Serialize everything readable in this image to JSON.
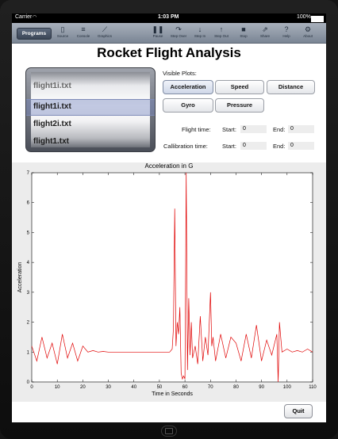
{
  "status": {
    "carrier": "Carrier",
    "time": "1:03 PM",
    "battery": "100%"
  },
  "toolbar": {
    "programs": "Programs",
    "items": [
      {
        "label": "Source",
        "icon": "document-icon"
      },
      {
        "label": "Console",
        "icon": "console-icon"
      },
      {
        "label": "Graphics",
        "icon": "graph-icon"
      },
      {
        "label": "Pause",
        "icon": "pause-icon"
      },
      {
        "label": "Step Over",
        "icon": "step-over-icon"
      },
      {
        "label": "Step In",
        "icon": "step-in-icon"
      },
      {
        "label": "Step Out",
        "icon": "step-out-icon"
      },
      {
        "label": "Stop",
        "icon": "stop-icon"
      },
      {
        "label": "Share",
        "icon": "share-icon"
      },
      {
        "label": "Help",
        "icon": "help-icon"
      },
      {
        "label": "About",
        "icon": "gear-icon"
      }
    ]
  },
  "title": "Rocket Flight Analysis",
  "files": {
    "above": "flight1i.txt",
    "selected": "flight1i.txt",
    "next": "flight2i.txt",
    "below": "flight1.txt"
  },
  "plots": {
    "label": "Visible Plots:",
    "buttons": [
      "Acceleration",
      "Speed",
      "Distance",
      "Gyro",
      "Pressure"
    ]
  },
  "times": {
    "flight_label": "Flight time:",
    "calib_label": "Callibration time:",
    "start": "Start:",
    "end": "End:",
    "flight_start": "0",
    "flight_end": "0",
    "calib_start": "0",
    "calib_end": "0"
  },
  "chart_data": {
    "type": "line",
    "title": "Acceleration in G",
    "xlabel": "Time in Seconds",
    "ylabel": "Acceleration",
    "xlim": [
      0,
      110
    ],
    "ylim": [
      0,
      7
    ],
    "xticks": [
      0,
      10,
      20,
      30,
      40,
      50,
      60,
      70,
      80,
      90,
      100,
      110
    ],
    "yticks": [
      0,
      1,
      2,
      3,
      4,
      5,
      6,
      7
    ],
    "color": "#e00000",
    "x": [
      0,
      2,
      4,
      6,
      8,
      10,
      12,
      14,
      16,
      18,
      20,
      22,
      24,
      26,
      28,
      30,
      32,
      34,
      36,
      38,
      40,
      42,
      44,
      46,
      48,
      50,
      52,
      54,
      55,
      55.5,
      56,
      56.5,
      57,
      57.5,
      58,
      58.5,
      59,
      59.5,
      60,
      60.5,
      61,
      61.5,
      62,
      62.5,
      63,
      64,
      65,
      66,
      67,
      68,
      69,
      70,
      70.5,
      71,
      72,
      74,
      76,
      78,
      80,
      82,
      84,
      86,
      88,
      90,
      92,
      94,
      96,
      96.5,
      97,
      98,
      100,
      102,
      104,
      106,
      108,
      110
    ],
    "y": [
      1.2,
      0.7,
      1.5,
      0.8,
      1.3,
      0.6,
      1.6,
      0.8,
      1.3,
      0.7,
      1.2,
      1.0,
      1.05,
      1.0,
      1.02,
      1.0,
      1.0,
      1.0,
      1.0,
      1.0,
      1.0,
      1.0,
      1.0,
      1.0,
      1.0,
      1.0,
      1.0,
      1.0,
      1.1,
      1.8,
      5.8,
      1.2,
      2.0,
      1.6,
      2.5,
      0.3,
      0.1,
      0.2,
      0.1,
      7.0,
      0.4,
      2.8,
      0.9,
      2.0,
      0.8,
      1.2,
      0.6,
      2.2,
      0.7,
      1.5,
      0.9,
      3.0,
      1.2,
      1.5,
      0.7,
      1.6,
      0.8,
      1.5,
      1.3,
      0.7,
      1.6,
      0.8,
      1.9,
      0.7,
      1.4,
      0.9,
      1.6,
      0.0,
      2.0,
      1.0,
      1.1,
      1.0,
      1.05,
      1.0,
      1.1,
      1.0
    ]
  },
  "quit": "Quit"
}
